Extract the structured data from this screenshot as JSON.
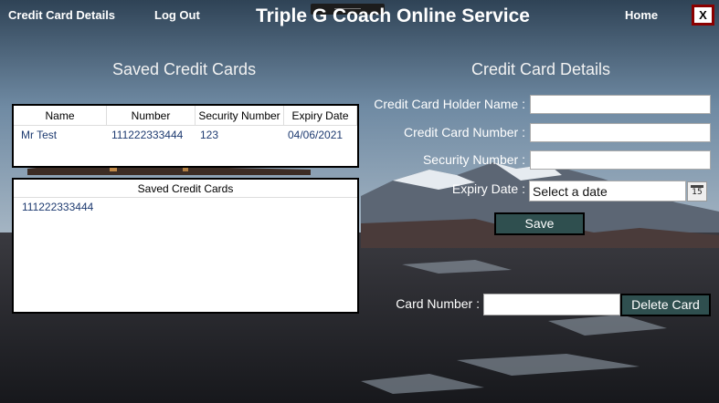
{
  "window": {
    "app_title": "Triple G Coach Online Service",
    "close_label": "X"
  },
  "nav": {
    "credit_card_details": "Credit Card Details",
    "log_out": "Log Out",
    "home": "Home"
  },
  "saved_section": {
    "heading": "Saved Credit Cards",
    "grid": {
      "columns": [
        "Name",
        "Number",
        "Security Number",
        "Expiry Date"
      ],
      "rows": [
        [
          "Mr Test",
          "111222333444",
          "123",
          "04/06/2021"
        ]
      ]
    },
    "list": {
      "header": "Saved Credit Cards",
      "items": [
        "111222333444"
      ]
    }
  },
  "details_section": {
    "heading": "Credit Card Details",
    "holder_name_label": "Credit Card Holder Name :",
    "holder_name_value": "",
    "number_label": "Credit Card Number :",
    "number_value": "",
    "security_label": "Security Number :",
    "security_value": "",
    "expiry_label": "Expiry Date :",
    "expiry_placeholder": "Select a date",
    "calendar_day": "15",
    "save_label": "Save"
  },
  "delete_section": {
    "card_number_label": "Card Number :",
    "card_number_value": "",
    "delete_label": "Delete Card"
  },
  "colors": {
    "button_bg": "#2f4f4f",
    "close_border": "#8b0000",
    "grid_text": "#1d3a70"
  }
}
